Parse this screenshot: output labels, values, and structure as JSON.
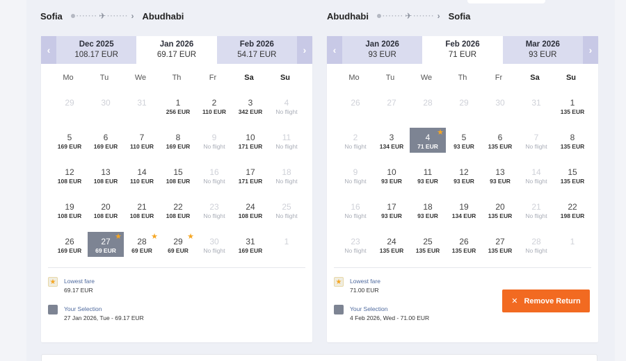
{
  "outbound": {
    "from": "Sofia",
    "to": "Abudhabi",
    "nav_prev": "‹",
    "nav_next": "›",
    "months": [
      {
        "name": "Dec 2025",
        "price": "108.17 EUR",
        "active": false
      },
      {
        "name": "Jan 2026",
        "price": "69.17 EUR",
        "active": true
      },
      {
        "name": "Feb 2026",
        "price": "54.17 EUR",
        "active": false
      }
    ],
    "weekdays": [
      "Mo",
      "Tu",
      "We",
      "Th",
      "Fr",
      "Sa",
      "Su"
    ],
    "days": [
      {
        "d": "29",
        "p": "",
        "s": "dim"
      },
      {
        "d": "30",
        "p": "",
        "s": "dim"
      },
      {
        "d": "31",
        "p": "",
        "s": "dim"
      },
      {
        "d": "1",
        "p": "256 EUR",
        "s": ""
      },
      {
        "d": "2",
        "p": "110 EUR",
        "s": ""
      },
      {
        "d": "3",
        "p": "342 EUR",
        "s": ""
      },
      {
        "d": "4",
        "p": "No flight",
        "s": "nf"
      },
      {
        "d": "5",
        "p": "169 EUR",
        "s": ""
      },
      {
        "d": "6",
        "p": "169 EUR",
        "s": ""
      },
      {
        "d": "7",
        "p": "110 EUR",
        "s": ""
      },
      {
        "d": "8",
        "p": "169 EUR",
        "s": ""
      },
      {
        "d": "9",
        "p": "No flight",
        "s": "nf"
      },
      {
        "d": "10",
        "p": "171 EUR",
        "s": ""
      },
      {
        "d": "11",
        "p": "No flight",
        "s": "nf"
      },
      {
        "d": "12",
        "p": "108 EUR",
        "s": ""
      },
      {
        "d": "13",
        "p": "108 EUR",
        "s": ""
      },
      {
        "d": "14",
        "p": "110 EUR",
        "s": ""
      },
      {
        "d": "15",
        "p": "108 EUR",
        "s": ""
      },
      {
        "d": "16",
        "p": "No flight",
        "s": "nf"
      },
      {
        "d": "17",
        "p": "171 EUR",
        "s": ""
      },
      {
        "d": "18",
        "p": "No flight",
        "s": "nf"
      },
      {
        "d": "19",
        "p": "108 EUR",
        "s": ""
      },
      {
        "d": "20",
        "p": "108 EUR",
        "s": ""
      },
      {
        "d": "21",
        "p": "108 EUR",
        "s": ""
      },
      {
        "d": "22",
        "p": "108 EUR",
        "s": ""
      },
      {
        "d": "23",
        "p": "No flight",
        "s": "nf"
      },
      {
        "d": "24",
        "p": "108 EUR",
        "s": ""
      },
      {
        "d": "25",
        "p": "No flight",
        "s": "nf"
      },
      {
        "d": "26",
        "p": "169 EUR",
        "s": ""
      },
      {
        "d": "27",
        "p": "69 EUR",
        "s": "sel",
        "star": true
      },
      {
        "d": "28",
        "p": "69 EUR",
        "s": "",
        "star": true
      },
      {
        "d": "29",
        "p": "69 EUR",
        "s": "",
        "star": true
      },
      {
        "d": "30",
        "p": "No flight",
        "s": "nf"
      },
      {
        "d": "31",
        "p": "169 EUR",
        "s": ""
      },
      {
        "d": "1",
        "p": "",
        "s": "dim"
      }
    ],
    "legend": {
      "lowest_label": "Lowest fare",
      "lowest_value": "69.17 EUR",
      "selection_label": "Your Selection",
      "selection_value": "27 Jan 2026, Tue - 69.17 EUR"
    }
  },
  "return": {
    "from": "Abudhabi",
    "to": "Sofia",
    "nav_prev": "‹",
    "nav_next": "›",
    "months": [
      {
        "name": "Jan 2026",
        "price": "93 EUR",
        "active": false
      },
      {
        "name": "Feb 2026",
        "price": "71 EUR",
        "active": true
      },
      {
        "name": "Mar 2026",
        "price": "93 EUR",
        "active": false
      }
    ],
    "weekdays": [
      "Mo",
      "Tu",
      "We",
      "Th",
      "Fr",
      "Sa",
      "Su"
    ],
    "days": [
      {
        "d": "26",
        "p": "",
        "s": "dim"
      },
      {
        "d": "27",
        "p": "",
        "s": "dim"
      },
      {
        "d": "28",
        "p": "",
        "s": "dim"
      },
      {
        "d": "29",
        "p": "",
        "s": "dim"
      },
      {
        "d": "30",
        "p": "",
        "s": "dim"
      },
      {
        "d": "31",
        "p": "",
        "s": "dim"
      },
      {
        "d": "1",
        "p": "135 EUR",
        "s": ""
      },
      {
        "d": "2",
        "p": "No flight",
        "s": "nf"
      },
      {
        "d": "3",
        "p": "134 EUR",
        "s": ""
      },
      {
        "d": "4",
        "p": "71 EUR",
        "s": "sel",
        "star": true
      },
      {
        "d": "5",
        "p": "93 EUR",
        "s": ""
      },
      {
        "d": "6",
        "p": "135 EUR",
        "s": ""
      },
      {
        "d": "7",
        "p": "No flight",
        "s": "nf"
      },
      {
        "d": "8",
        "p": "135 EUR",
        "s": ""
      },
      {
        "d": "9",
        "p": "No flight",
        "s": "nf"
      },
      {
        "d": "10",
        "p": "93 EUR",
        "s": ""
      },
      {
        "d": "11",
        "p": "93 EUR",
        "s": ""
      },
      {
        "d": "12",
        "p": "93 EUR",
        "s": ""
      },
      {
        "d": "13",
        "p": "93 EUR",
        "s": ""
      },
      {
        "d": "14",
        "p": "No flight",
        "s": "nf"
      },
      {
        "d": "15",
        "p": "135 EUR",
        "s": ""
      },
      {
        "d": "16",
        "p": "No flight",
        "s": "nf"
      },
      {
        "d": "17",
        "p": "93 EUR",
        "s": ""
      },
      {
        "d": "18",
        "p": "93 EUR",
        "s": ""
      },
      {
        "d": "19",
        "p": "134 EUR",
        "s": ""
      },
      {
        "d": "20",
        "p": "135 EUR",
        "s": ""
      },
      {
        "d": "21",
        "p": "No flight",
        "s": "nf"
      },
      {
        "d": "22",
        "p": "198 EUR",
        "s": ""
      },
      {
        "d": "23",
        "p": "No flight",
        "s": "nf"
      },
      {
        "d": "24",
        "p": "135 EUR",
        "s": ""
      },
      {
        "d": "25",
        "p": "135 EUR",
        "s": ""
      },
      {
        "d": "26",
        "p": "135 EUR",
        "s": ""
      },
      {
        "d": "27",
        "p": "135 EUR",
        "s": ""
      },
      {
        "d": "28",
        "p": "No flight",
        "s": "nf"
      },
      {
        "d": "1",
        "p": "",
        "s": "dim"
      }
    ],
    "legend": {
      "lowest_label": "Lowest fare",
      "lowest_value": "71.00 EUR",
      "selection_label": "Your Selection",
      "selection_value": "4 Feb 2026, Wed - 71.00 EUR"
    },
    "remove_label": "Remove Return",
    "remove_icon": "close-icon"
  },
  "colors": {
    "accent": "#f26a21",
    "selected": "#7d8493",
    "star": "#f5a623",
    "month_bg": "#dadcef",
    "nav_bg": "#c8c9e6"
  }
}
